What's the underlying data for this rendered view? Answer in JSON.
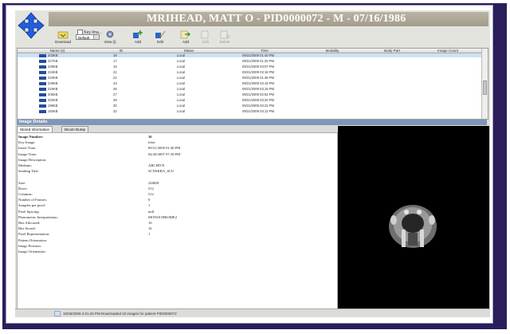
{
  "window": {
    "title": "MRIHEAD, MATT O - PID0000072 - M - 07/16/1986"
  },
  "toolbar": {
    "download_label": "Download",
    "key_image_label": "Key Ima...",
    "select_value": "Default",
    "view_label": "View (i)",
    "add1_label": "Add",
    "edit1_label": "Edit",
    "add2_label": "Add",
    "edit2_label": "Edit",
    "delete_label": "Delete"
  },
  "table": {
    "columns": [
      "Name (2)",
      "ID",
      "Status",
      "Time",
      "Modality",
      "Body Part",
      "Image Count"
    ],
    "rows": [
      {
        "name": "203KB",
        "id": "16",
        "status": "Local",
        "time": "09/21/2009 01:40 PM",
        "selected": true
      },
      {
        "name": "227KB",
        "id": "17",
        "status": "Local",
        "time": "09/21/2009 01:25 PM",
        "selected": false
      },
      {
        "name": "229KB",
        "id": "19",
        "status": "Local",
        "time": "09/21/2009 03:07 PM",
        "selected": false
      },
      {
        "name": "234KB",
        "id": "21",
        "status": "Local",
        "time": "09/21/2009 03:18 PM",
        "selected": false
      },
      {
        "name": "223KB",
        "id": "22",
        "status": "Local",
        "time": "09/21/2009 01:48 PM",
        "selected": false
      },
      {
        "name": "229KB",
        "id": "23",
        "status": "Local",
        "time": "09/21/2009 03:18 PM",
        "selected": false
      },
      {
        "name": "218KB",
        "id": "26",
        "status": "Local",
        "time": "09/21/2009 03:18 PM",
        "selected": false
      },
      {
        "name": "205KB",
        "id": "27",
        "status": "Local",
        "time": "09/21/2009 02:52 PM",
        "selected": false
      },
      {
        "name": "202KB",
        "id": "28",
        "status": "Local",
        "time": "09/21/2009 03:20 PM",
        "selected": false
      },
      {
        "name": "199KB",
        "id": "30",
        "status": "Local",
        "time": "09/21/2009 03:22 PM",
        "selected": false
      },
      {
        "name": "183KB",
        "id": "32",
        "status": "Local",
        "time": "09/21/2009 03:13 PM",
        "selected": false
      }
    ]
  },
  "details": {
    "header": "Image Details",
    "tabs": [
      "Stored Information",
      "Dicom Dump"
    ],
    "fields": [
      {
        "k": "Image Number:",
        "v": "16",
        "bold": true
      },
      {
        "k": "Key Image:",
        "v": "false"
      },
      {
        "k": "Insert Time:",
        "v": "09/21/2009 01:40 PM"
      },
      {
        "k": "Image Time:",
        "v": "04/28/2007 07:38 PM"
      },
      {
        "k": "Image Description:",
        "v": ""
      },
      {
        "k": "Medium:",
        "v": "ARCHIVE"
      },
      {
        "k": "Sending Title:",
        "v": "SCNSKRA_SCU"
      },
      {
        "k": "",
        "v": ""
      },
      {
        "k": "Size:",
        "v": "226KB"
      },
      {
        "k": "Rows:",
        "v": "512"
      },
      {
        "k": "Columns:",
        "v": "512"
      },
      {
        "k": "Number of Frames:",
        "v": "0"
      },
      {
        "k": "Samples per pixel:",
        "v": "1"
      },
      {
        "k": "Pixel Spacing:",
        "v": "null"
      },
      {
        "k": "Photometric Interpretation:",
        "v": "MONOCHROME2"
      },
      {
        "k": "Bits Allocated:",
        "v": "16"
      },
      {
        "k": "Bits Stored:",
        "v": "16"
      },
      {
        "k": "Pixel Representation:",
        "v": "1"
      },
      {
        "k": "Patient Orientation:",
        "v": ""
      },
      {
        "k": "Image Position:",
        "v": ""
      },
      {
        "k": "Image Orientation:",
        "v": ""
      }
    ]
  },
  "statusbar": {
    "message": "10/25/2009 4:21:40 PM   Downloaded 10 images for patient PID0000072"
  }
}
